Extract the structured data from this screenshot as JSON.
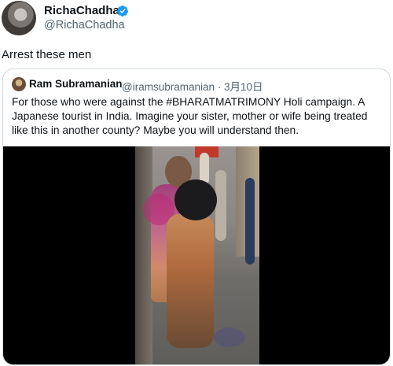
{
  "author": {
    "display_name": "RichaChadha",
    "handle": "@RichaChadha",
    "verified_icon": "verified-badge-icon",
    "verified_color": "#1d9bf0"
  },
  "tweet": {
    "text": "Arrest these men"
  },
  "quoted": {
    "display_name": "Ram Subramanian",
    "handle": "@iramsubramanian",
    "separator": "·",
    "date": "3月10日",
    "text": "For those who were against the #BHARATMATRIMONY Holi campaign.  A Japanese tourist in India. Imagine your sister, mother or wife being treated like this in another county? Maybe you will understand then."
  },
  "media": {
    "type": "video"
  }
}
